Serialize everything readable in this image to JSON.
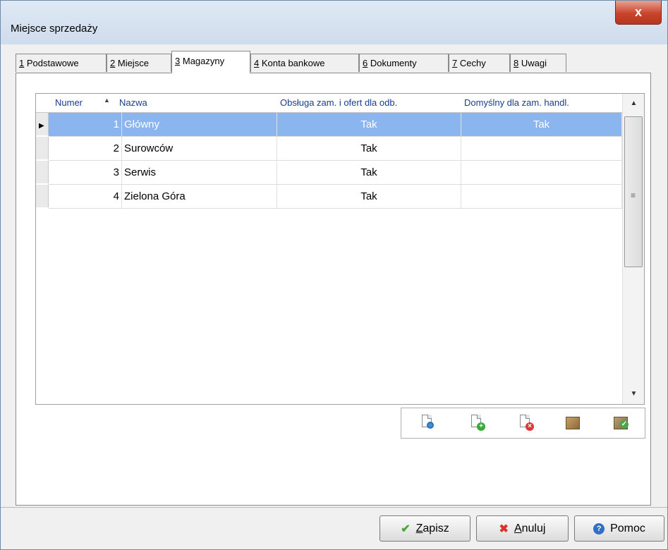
{
  "window": {
    "title": "Miejsce sprzedaży",
    "close_symbol": "x"
  },
  "tabs": [
    {
      "key": "1",
      "label": "Podstawowe"
    },
    {
      "key": "2",
      "label": "Miejsce"
    },
    {
      "key": "3",
      "label": "Magazyny",
      "active": true
    },
    {
      "key": "4",
      "label": "Konta bankowe"
    },
    {
      "key": "6",
      "label": "Dokumenty"
    },
    {
      "key": "7",
      "label": "Cechy"
    },
    {
      "key": "8",
      "label": "Uwagi"
    }
  ],
  "grid": {
    "columns": [
      "Numer",
      "Nazwa",
      "Obsługa zam. i ofert dla odb.",
      "Domyślny dla zam.  handl."
    ],
    "sort_indicator": "▲",
    "rows": [
      {
        "numer": "1",
        "nazwa": "Główny",
        "obsluga": "Tak",
        "domyslny": "Tak",
        "selected": true,
        "indicator": "▶"
      },
      {
        "numer": "2",
        "nazwa": "Surowców",
        "obsluga": "Tak",
        "domyslny": ""
      },
      {
        "numer": "3",
        "nazwa": "Serwis",
        "obsluga": "Tak",
        "domyslny": ""
      },
      {
        "numer": "4",
        "nazwa": "Zielona Góra",
        "obsluga": "Tak",
        "domyslny": ""
      }
    ]
  },
  "toolbar_icons": [
    "view-document-icon",
    "add-document-icon",
    "delete-document-icon",
    "warehouse-box-icon",
    "approve-icon"
  ],
  "buttons": {
    "save": {
      "label": "Zapisz",
      "underline": "Z"
    },
    "cancel": {
      "label": "Anuluj",
      "underline": "A"
    },
    "help": {
      "label": "Pomoc"
    }
  },
  "colors": {
    "selection": "#8bb5ef",
    "header_text": "#1a3d8f",
    "close_button": "#c8442b"
  }
}
